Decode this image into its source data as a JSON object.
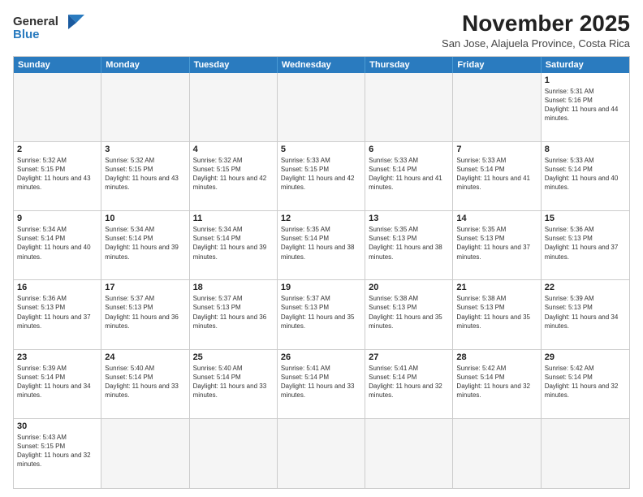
{
  "logo": {
    "line1": "General",
    "line2": "Blue"
  },
  "header": {
    "month": "November 2025",
    "location": "San Jose, Alajuela Province, Costa Rica"
  },
  "days": [
    "Sunday",
    "Monday",
    "Tuesday",
    "Wednesday",
    "Thursday",
    "Friday",
    "Saturday"
  ],
  "weeks": [
    [
      {
        "day": "",
        "empty": true
      },
      {
        "day": "",
        "empty": true
      },
      {
        "day": "",
        "empty": true
      },
      {
        "day": "",
        "empty": true
      },
      {
        "day": "",
        "empty": true
      },
      {
        "day": "",
        "empty": true
      },
      {
        "day": "1",
        "sunrise": "5:31 AM",
        "sunset": "5:16 PM",
        "daylight": "11 hours and 44 minutes."
      }
    ],
    [
      {
        "day": "2",
        "sunrise": "5:32 AM",
        "sunset": "5:15 PM",
        "daylight": "11 hours and 43 minutes."
      },
      {
        "day": "3",
        "sunrise": "5:32 AM",
        "sunset": "5:15 PM",
        "daylight": "11 hours and 43 minutes."
      },
      {
        "day": "4",
        "sunrise": "5:32 AM",
        "sunset": "5:15 PM",
        "daylight": "11 hours and 42 minutes."
      },
      {
        "day": "5",
        "sunrise": "5:33 AM",
        "sunset": "5:15 PM",
        "daylight": "11 hours and 42 minutes."
      },
      {
        "day": "6",
        "sunrise": "5:33 AM",
        "sunset": "5:14 PM",
        "daylight": "11 hours and 41 minutes."
      },
      {
        "day": "7",
        "sunrise": "5:33 AM",
        "sunset": "5:14 PM",
        "daylight": "11 hours and 41 minutes."
      },
      {
        "day": "8",
        "sunrise": "5:33 AM",
        "sunset": "5:14 PM",
        "daylight": "11 hours and 40 minutes."
      }
    ],
    [
      {
        "day": "9",
        "sunrise": "5:34 AM",
        "sunset": "5:14 PM",
        "daylight": "11 hours and 40 minutes."
      },
      {
        "day": "10",
        "sunrise": "5:34 AM",
        "sunset": "5:14 PM",
        "daylight": "11 hours and 39 minutes."
      },
      {
        "day": "11",
        "sunrise": "5:34 AM",
        "sunset": "5:14 PM",
        "daylight": "11 hours and 39 minutes."
      },
      {
        "day": "12",
        "sunrise": "5:35 AM",
        "sunset": "5:14 PM",
        "daylight": "11 hours and 38 minutes."
      },
      {
        "day": "13",
        "sunrise": "5:35 AM",
        "sunset": "5:13 PM",
        "daylight": "11 hours and 38 minutes."
      },
      {
        "day": "14",
        "sunrise": "5:35 AM",
        "sunset": "5:13 PM",
        "daylight": "11 hours and 37 minutes."
      },
      {
        "day": "15",
        "sunrise": "5:36 AM",
        "sunset": "5:13 PM",
        "daylight": "11 hours and 37 minutes."
      }
    ],
    [
      {
        "day": "16",
        "sunrise": "5:36 AM",
        "sunset": "5:13 PM",
        "daylight": "11 hours and 37 minutes."
      },
      {
        "day": "17",
        "sunrise": "5:37 AM",
        "sunset": "5:13 PM",
        "daylight": "11 hours and 36 minutes."
      },
      {
        "day": "18",
        "sunrise": "5:37 AM",
        "sunset": "5:13 PM",
        "daylight": "11 hours and 36 minutes."
      },
      {
        "day": "19",
        "sunrise": "5:37 AM",
        "sunset": "5:13 PM",
        "daylight": "11 hours and 35 minutes."
      },
      {
        "day": "20",
        "sunrise": "5:38 AM",
        "sunset": "5:13 PM",
        "daylight": "11 hours and 35 minutes."
      },
      {
        "day": "21",
        "sunrise": "5:38 AM",
        "sunset": "5:13 PM",
        "daylight": "11 hours and 35 minutes."
      },
      {
        "day": "22",
        "sunrise": "5:39 AM",
        "sunset": "5:13 PM",
        "daylight": "11 hours and 34 minutes."
      }
    ],
    [
      {
        "day": "23",
        "sunrise": "5:39 AM",
        "sunset": "5:14 PM",
        "daylight": "11 hours and 34 minutes."
      },
      {
        "day": "24",
        "sunrise": "5:40 AM",
        "sunset": "5:14 PM",
        "daylight": "11 hours and 33 minutes."
      },
      {
        "day": "25",
        "sunrise": "5:40 AM",
        "sunset": "5:14 PM",
        "daylight": "11 hours and 33 minutes."
      },
      {
        "day": "26",
        "sunrise": "5:41 AM",
        "sunset": "5:14 PM",
        "daylight": "11 hours and 33 minutes."
      },
      {
        "day": "27",
        "sunrise": "5:41 AM",
        "sunset": "5:14 PM",
        "daylight": "11 hours and 32 minutes."
      },
      {
        "day": "28",
        "sunrise": "5:42 AM",
        "sunset": "5:14 PM",
        "daylight": "11 hours and 32 minutes."
      },
      {
        "day": "29",
        "sunrise": "5:42 AM",
        "sunset": "5:14 PM",
        "daylight": "11 hours and 32 minutes."
      }
    ],
    [
      {
        "day": "30",
        "sunrise": "5:43 AM",
        "sunset": "5:15 PM",
        "daylight": "11 hours and 32 minutes."
      },
      {
        "day": "",
        "empty": true
      },
      {
        "day": "",
        "empty": true
      },
      {
        "day": "",
        "empty": true
      },
      {
        "day": "",
        "empty": true
      },
      {
        "day": "",
        "empty": true
      },
      {
        "day": "",
        "empty": true
      }
    ]
  ],
  "labels": {
    "sunrise": "Sunrise:",
    "sunset": "Sunset:",
    "daylight": "Daylight:"
  }
}
